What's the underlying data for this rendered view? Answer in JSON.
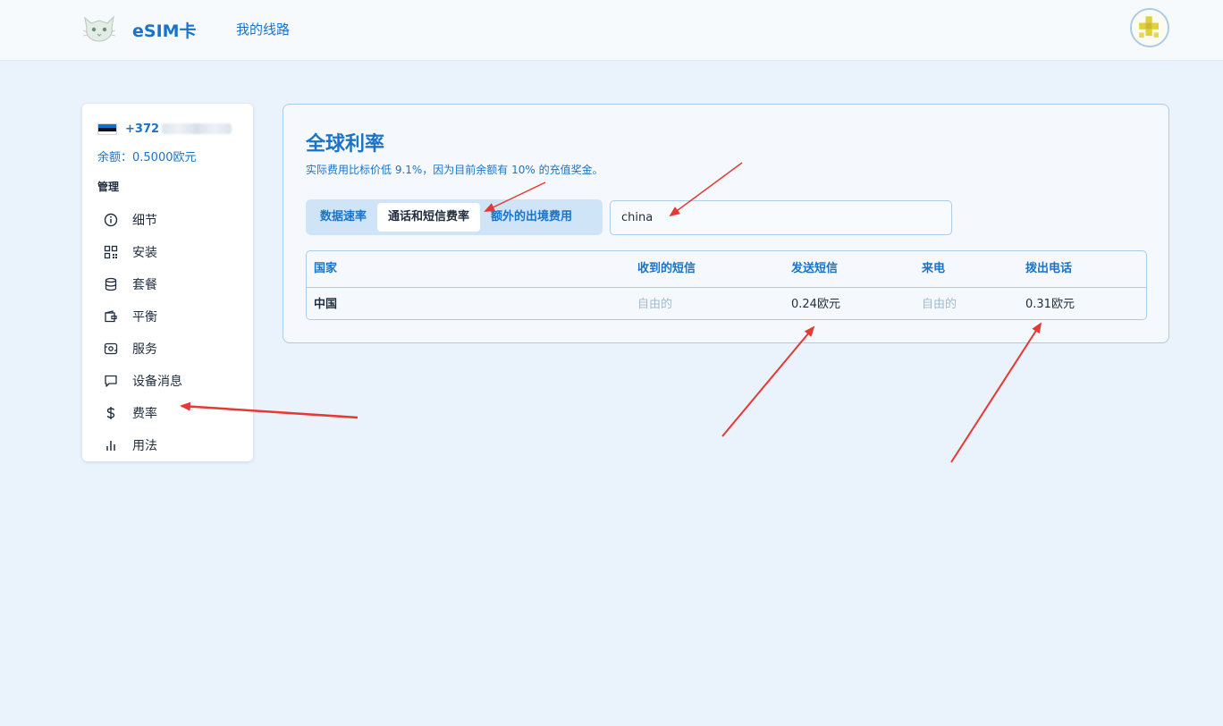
{
  "header": {
    "brand": "eSIM卡",
    "nav_my_lines": "我的线路",
    "logo_icon": "cat-logo-icon",
    "avatar_icon": "pixel-avatar-icon"
  },
  "sidebar": {
    "phone_prefix": "+372",
    "flag": "estonia-flag-icon",
    "balance": "余额：0.5000欧元",
    "section_title": "管理",
    "items": [
      {
        "label": "细节",
        "icon": "info-icon"
      },
      {
        "label": "安装",
        "icon": "qr-code-icon"
      },
      {
        "label": "套餐",
        "icon": "database-icon"
      },
      {
        "label": "平衡",
        "icon": "wallet-icon"
      },
      {
        "label": "服务",
        "icon": "service-icon"
      },
      {
        "label": "设备消息",
        "icon": "message-icon"
      },
      {
        "label": "费率",
        "icon": "dollar-icon"
      },
      {
        "label": "用法",
        "icon": "bar-chart-icon"
      }
    ]
  },
  "main": {
    "title": "全球利率",
    "subtitle": "实际费用比标价低 9.1%，因为目前余额有 10% 的充值奖金。",
    "tabs": [
      {
        "label": "数据速率",
        "active": false
      },
      {
        "label": "通话和短信费率",
        "active": true
      },
      {
        "label": "额外的出境费用",
        "active": false
      }
    ],
    "search": {
      "value": "china",
      "placeholder": ""
    },
    "table": {
      "headers": [
        "国家",
        "收到的短信",
        "发送短信",
        "来电",
        "拨出电话"
      ],
      "rows": [
        {
          "country": "中国",
          "sms_in": "自由的",
          "sms_out": "0.24欧元",
          "call_in": "自由的",
          "call_out": "0.31欧元"
        }
      ]
    }
  },
  "colors": {
    "accent": "#1a73c9",
    "page_bg": "#eaf3fb",
    "annotation_arrow": "#e53935"
  }
}
